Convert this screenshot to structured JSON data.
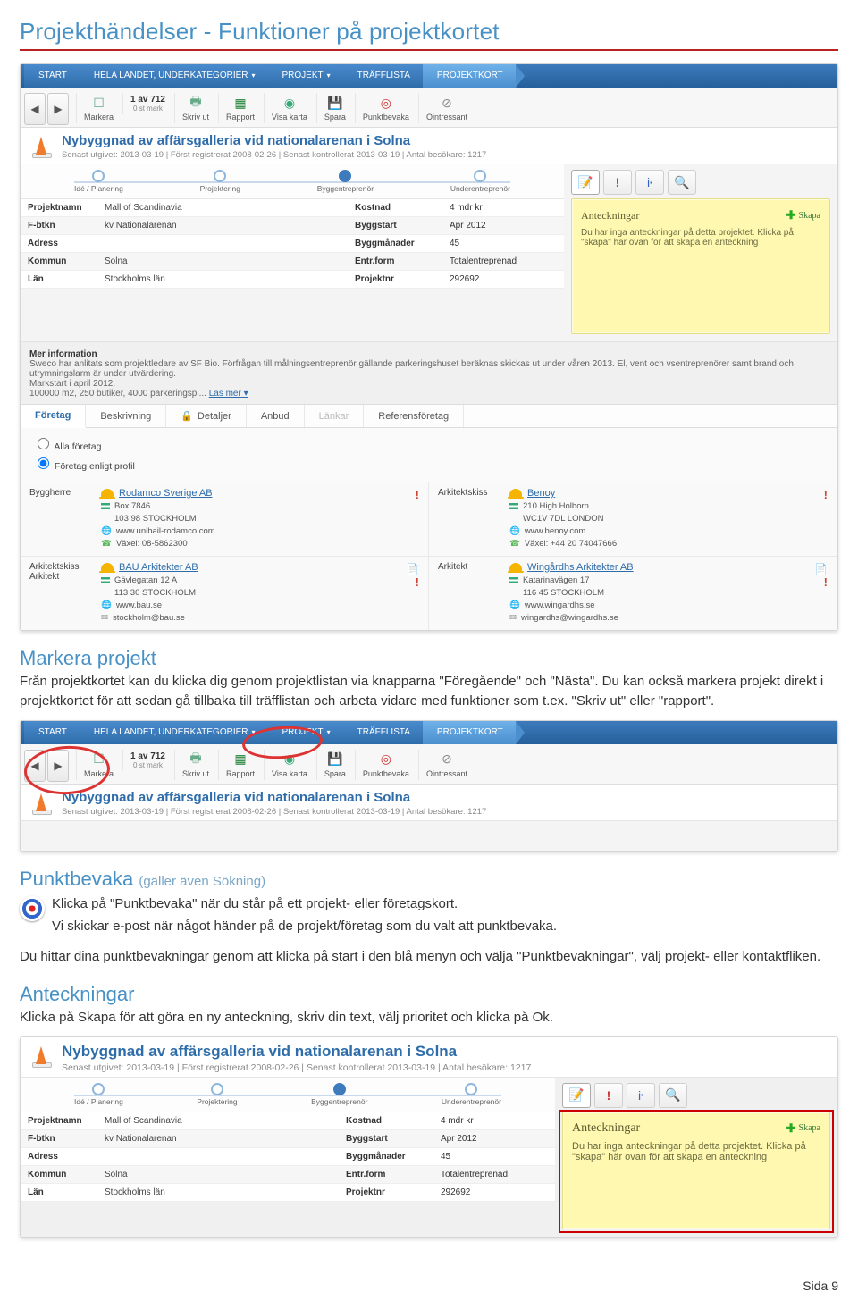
{
  "doc": {
    "title": "Projekthändelser - Funktioner på projektkortet",
    "footer": "Sida 9"
  },
  "breadcrumb": [
    "START",
    "HELA LANDET, UNDERKATEGORIER",
    "PROJEKT",
    "TRÄFFLISTA",
    "PROJEKTKORT"
  ],
  "toolbar": {
    "count": "1 av 712",
    "count_sub": "0 st mark",
    "items": [
      "Markera",
      "Skriv ut",
      "Rapport",
      "Visa karta",
      "Spara",
      "Punktbevaka",
      "Ointressant"
    ]
  },
  "project": {
    "title": "Nybyggnad av affärsgalleria vid nationalarenan i Solna",
    "meta": "Senast utgivet: 2013-03-19 | Först registrerat 2008-02-26 | Senast kontrollerat 2013-03-19 | Antal besökare: 1217"
  },
  "phases": [
    "Idé / Planering",
    "Projektering",
    "Byggentreprenör",
    "Underentreprenör"
  ],
  "facts": {
    "rows": [
      {
        "l": "Projektnamn",
        "v": "Mall of Scandinavia",
        "l2": "Kostnad",
        "v2": "4 mdr kr"
      },
      {
        "l": "F-btkn",
        "v": "kv Nationalarenan",
        "l2": "Byggstart",
        "v2": "Apr 2012"
      },
      {
        "l": "Adress",
        "v": "",
        "l2": "Byggmånader",
        "v2": "45"
      },
      {
        "l": "Kommun",
        "v": "Solna",
        "l2": "Entr.form",
        "v2": "Totalentreprenad"
      },
      {
        "l": "Län",
        "v": "Stockholms län",
        "l2": "Projektnr",
        "v2": "292692"
      }
    ]
  },
  "notes": {
    "header": "Anteckningar",
    "create": "Skapa",
    "body": "Du har inga anteckningar på detta projektet. Klicka på \"skapa\" här ovan för att skapa en anteckning"
  },
  "moreinfo": {
    "hd": "Mer information",
    "body": "Sweco har anlitats som projektledare av SF Bio. Förfrågan till målningsentreprenör gällande parkeringshuset beräknas skickas ut under våren 2013. El, vent och vsentreprenörer samt brand och utrymningslarm är under utvärdering.",
    "l2": "Markstart i april 2012.",
    "l3": "100000 m2, 250 butiker, 4000 parkeringspl...",
    "read": "Läs mer"
  },
  "tabs": [
    "Företag",
    "Beskrivning",
    "Detaljer",
    "Anbud",
    "Länkar",
    "Referensföretag"
  ],
  "radios": {
    "a": "Alla företag",
    "b": "Företag enligt profil"
  },
  "companies": [
    {
      "role": "Byggherre",
      "name": "Rodamco Sverige AB",
      "lines": [
        "Box 7846",
        "103 98 STOCKHOLM",
        "www.unibail-rodamco.com",
        "Växel: 08-5862300"
      ],
      "alert": true
    },
    {
      "role": "Arkitektskiss",
      "name": "Benoy",
      "lines": [
        "210 High Holborn",
        "WC1V 7DL LONDON",
        "www.benoy.com",
        "Växel: +44 20 74047666"
      ],
      "alert": true
    },
    {
      "role": "Arkitektskiss\nArkitekt",
      "name": "BAU Arkitekter AB",
      "lines": [
        "Gävlegatan 12 A",
        "113 30 STOCKHOLM",
        "www.bau.se",
        "stockholm@bau.se"
      ],
      "doc": true,
      "alert": true
    },
    {
      "role": "Arkitekt",
      "name": "Wingårdhs Arkitekter AB",
      "lines": [
        "Katarinavägen 17",
        "116 45 STOCKHOLM",
        "www.wingardhs.se",
        "wingardhs@wingardhs.se"
      ],
      "doc": true,
      "alert": true
    }
  ],
  "sec1": {
    "h": "Markera projekt",
    "p": "Från projektkortet kan du klicka dig genom projektlistan via knapparna \"Föregående\" och \"Nästa\". Du kan också markera projekt direkt i projektkortet för att sedan gå tillbaka till träfflistan och arbeta vidare med funktioner som t.ex. \"Skriv ut\" eller \"rapport\"."
  },
  "sec2": {
    "h": "Punktbevaka",
    "hnote": "(gäller även Sökning)",
    "p1": "Klicka på \"Punktbevaka\" när du står på ett projekt- eller företagskort.",
    "p2": "Vi skickar e-post när något händer på de projekt/företag som du valt att punktbevaka.",
    "p3": "Du hittar dina punktbevakningar genom att klicka på start i den blå menyn och välja \"Punktbevakningar\", välj projekt- eller kontaktfliken."
  },
  "sec3": {
    "h": "Anteckningar",
    "p": "Klicka på Skapa för att göra en ny anteckning, skriv din text, välj prioritet och klicka på Ok."
  },
  "icons": {
    "note": "📝",
    "warn": "!",
    "info": "iℹ",
    "mag": "🔍"
  }
}
